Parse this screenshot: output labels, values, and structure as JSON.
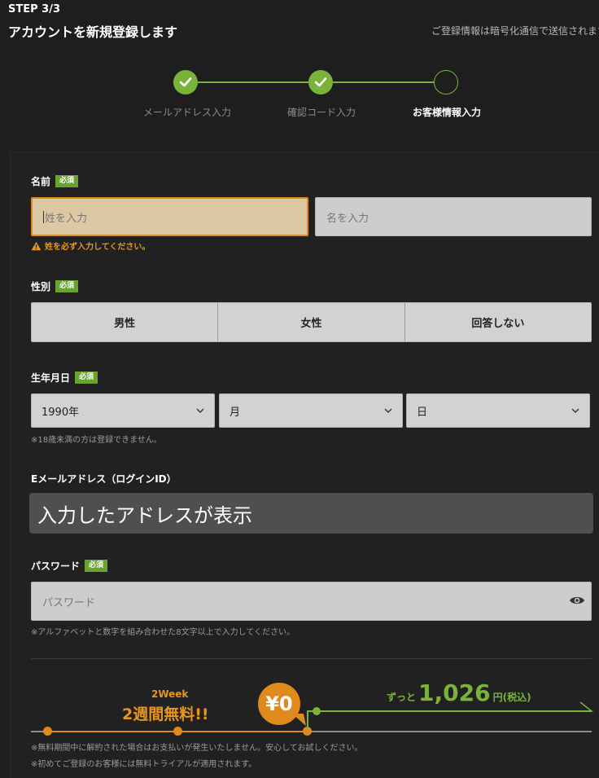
{
  "header": {
    "step": "STEP 3/3",
    "title": "アカウントを新規登録します",
    "secure_note": "ご登録情報は暗号化通信で送信されます"
  },
  "steps": [
    {
      "label": "メールアドレス入力",
      "state": "done"
    },
    {
      "label": "確認コード入力",
      "state": "done"
    },
    {
      "label": "お客様情報入力",
      "state": "current"
    }
  ],
  "form": {
    "required": "必須",
    "name": {
      "label": "名前",
      "last_placeholder": "姓を入力",
      "first_placeholder": "名を入力",
      "error": "姓を必ず入力してください。"
    },
    "gender": {
      "label": "性別",
      "options": [
        "男性",
        "女性",
        "回答しない"
      ]
    },
    "birthday": {
      "label": "生年月日",
      "year": "1990年",
      "month": "月",
      "day": "日",
      "hint": "※18歳未満の方は登録できません。"
    },
    "email": {
      "label": "Eメールアドレス（ログインID）",
      "value": "入力したアドレスが表示"
    },
    "password": {
      "label": "パスワード",
      "placeholder": "パスワード",
      "hint": "※アルファベットと数字を組み合わせた8文字以上で入力してください。"
    }
  },
  "trial": {
    "week": "2Week",
    "free": "2週間無料!!",
    "yen": "¥0",
    "price_prefix": "ずっと",
    "price": "1,026",
    "price_unit": "円(税込)",
    "note1": "※無料期間中に解約された場合はお支払いが発生いたしません。安心してお試しください。",
    "note2": "※初めてご登録のお客様には無料トライアルが適用されます。"
  },
  "colors": {
    "accent_green": "#7ab33a",
    "accent_orange": "#e08a1e",
    "background": "#1e1e1e"
  }
}
